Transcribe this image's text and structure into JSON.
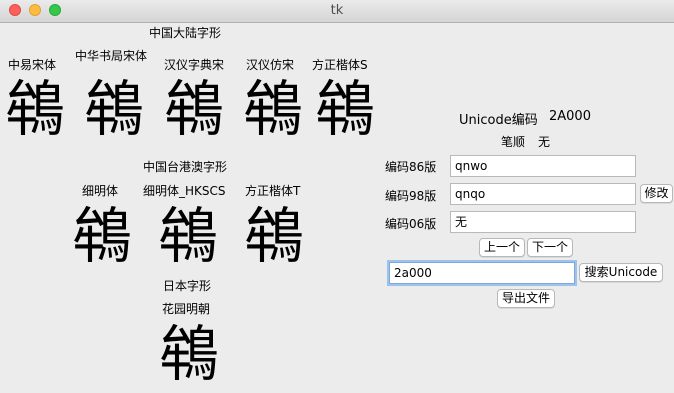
{
  "window": {
    "title": "tk"
  },
  "fonts_top": {
    "group_label": "中国大陆字形",
    "col1": "中易宋体",
    "col2": "中华书局宋体",
    "col3": "汉仪字典宋",
    "col4": "汉仪仿宋",
    "col5": "方正楷体S"
  },
  "fonts_tw": {
    "group_label": "中国台港澳字形",
    "col1": "细明体",
    "col2": "细明体_HKSCS",
    "col3": "方正楷体T"
  },
  "fonts_jp": {
    "group_label": "日本字形",
    "col1": "花园明朝"
  },
  "character": "鴾",
  "info": {
    "unicode_label": "Unicode编码",
    "unicode_value": "2A000",
    "strokes_label": "笔顺",
    "strokes_value": "无"
  },
  "codes": {
    "v86_label": "编码86版",
    "v86_value": "qnwo",
    "v98_label": "编码98版",
    "v98_value": "qnqo",
    "v06_label": "编码06版",
    "v06_value": "无",
    "edit_button": "修改"
  },
  "nav": {
    "prev": "上一个",
    "next": "下一个"
  },
  "search": {
    "value": "2a000",
    "button": "搜索Unicode"
  },
  "export_button": "导出文件"
}
